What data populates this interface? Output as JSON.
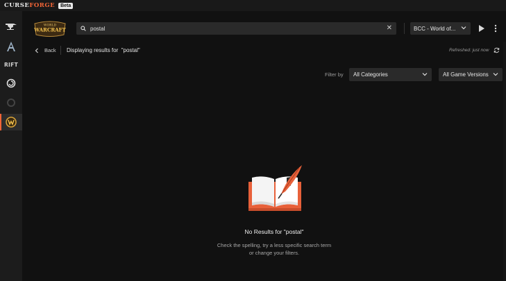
{
  "app": {
    "brand_left": "CURSE",
    "brand_right": "FORGE",
    "beta_label": "Beta"
  },
  "rail": {
    "items": [
      {
        "name": "anvil-game-icon"
      },
      {
        "name": "albion-game-icon"
      },
      {
        "name": "rift-game-icon",
        "text": "RIFT"
      },
      {
        "name": "swirl-game-icon"
      },
      {
        "name": "ring-game-icon"
      },
      {
        "name": "wow-game-icon",
        "active": true
      }
    ]
  },
  "header": {
    "logo_text_top": "WORLD",
    "logo_text_main": "WARCRAFT",
    "search_value": "postal",
    "clear_label": "✕",
    "game_version": "BCC - World of..."
  },
  "results": {
    "back_label": "Back",
    "title": "Displaying results for  \"postal\"",
    "refreshed": "Refreshed: just now"
  },
  "filters": {
    "label": "Filter by",
    "category": "All Categories",
    "game_version": "All Game Versions"
  },
  "empty_state": {
    "title": "No Results for \"postal\"",
    "line1": "Check the spelling, try a less specific search term",
    "line2": "or change your filters."
  },
  "colors": {
    "accent": "#f16436",
    "background": "#111111",
    "rail": "#1c1c1c",
    "input": "#2a2a2a"
  }
}
